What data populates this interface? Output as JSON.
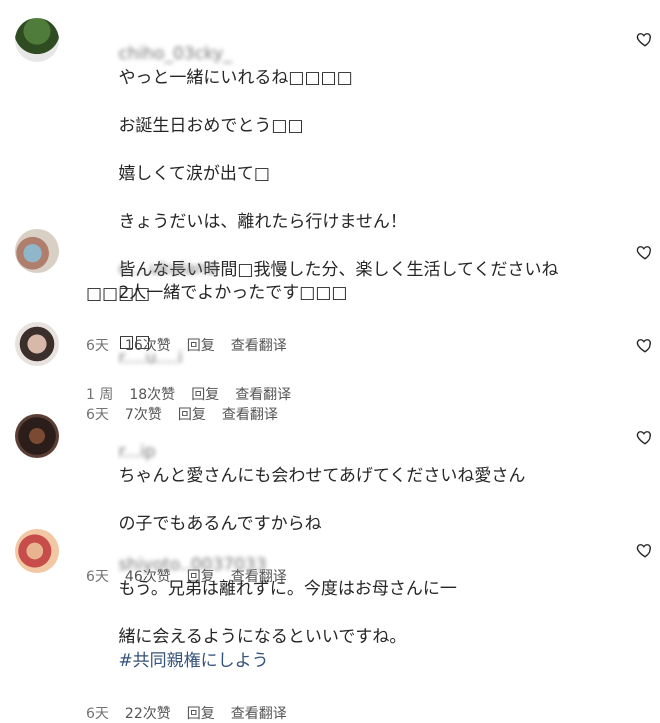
{
  "comments": [
    {
      "username": "chiho_03cky_",
      "text_lines": [
        "やっと一緒にいれるね□□□□",
        "お誕生日おめでとう□□",
        "嬉しくて涙が出て□",
        "きょうだいは、離れたら行けません！",
        "皆んな長い時間□我慢した分、楽しく生活してくださいね□□□□",
        "□□"
      ],
      "time": "1 周",
      "likes": "18次赞",
      "reply": "回复",
      "translate": "查看翻译"
    },
    {
      "username": "c....ukuland",
      "text_lines": [
        "2人一緒でよかったです□□□"
      ],
      "time": "6天",
      "likes": "16次赞",
      "reply": "回复",
      "translate": "查看翻译"
    },
    {
      "username": "r....u....i",
      "text_lines": [],
      "time": "6天",
      "likes": "7次赞",
      "reply": "回复",
      "translate": "查看翻译"
    },
    {
      "username": "r...ip",
      "text_lines": [
        "ちゃんと愛さんにも会わせてあげてくださいね愛さん",
        "の子でもあるんですからね"
      ],
      "time": "6天",
      "likes": "46次赞",
      "reply": "回复",
      "translate": "查看翻译"
    },
    {
      "username": "shiyoto..0037033",
      "text_lines": [
        "もう。兄弟は離れずに。今度はお母さんに一",
        "緒に会えるようになるといいですね。"
      ],
      "hashtag": "#共同親権にしよう",
      "time": "6天",
      "likes": "22次赞",
      "reply": "回复",
      "translate": "查看翻译"
    }
  ],
  "colors": {
    "text": "#262626",
    "meta": "#737373",
    "hashtag": "#35527a"
  },
  "icons": {
    "like": "heart-outline-icon"
  }
}
